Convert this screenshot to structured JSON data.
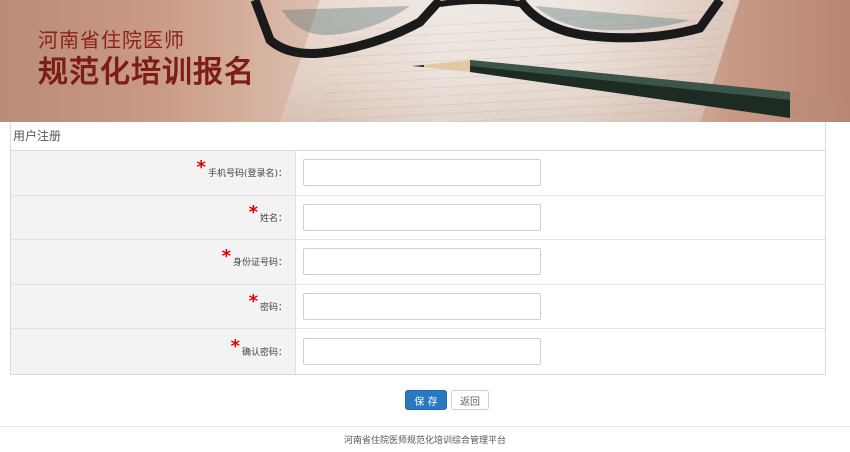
{
  "banner": {
    "title_line1": "河南省住院医师",
    "title_line2": "规范化培训报名"
  },
  "section": {
    "title": "用户注册"
  },
  "form": {
    "required_mark": "*",
    "fields": [
      {
        "label": "手机号码(登录名)：",
        "value": ""
      },
      {
        "label": "姓名：",
        "value": ""
      },
      {
        "label": "身份证号码：",
        "value": ""
      },
      {
        "label": "密码：",
        "value": ""
      },
      {
        "label": "确认密码：",
        "value": ""
      }
    ]
  },
  "buttons": {
    "save_label": "保 存",
    "back_label": "返回"
  },
  "footer": {
    "text": "河南省住院医师规范化培训综合管理平台"
  },
  "colors": {
    "brand_red": "#8e2218",
    "primary_button": "#2a78c2",
    "required": "#e00000"
  }
}
